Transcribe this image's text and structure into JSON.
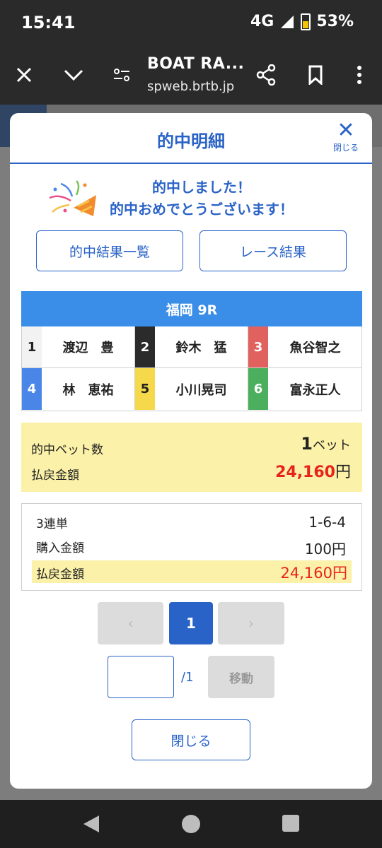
{
  "status_bar": {
    "time": "15:41",
    "network": "4G",
    "battery": "53%"
  },
  "browser": {
    "title": "BOAT RA...",
    "url": "spweb.brtb.jp"
  },
  "modal": {
    "title": "的中明細",
    "close_label": "閉じる",
    "congrats_line1": "的中しました！",
    "congrats_line2": "的中おめでとうございます！",
    "btn_hit_list": "的中結果一覧",
    "btn_race_result": "レース結果",
    "race_header": "福岡 9R",
    "racers": [
      {
        "num": "1",
        "name": "渡辺　豊",
        "bg": "#f2f2f2",
        "fg": "#222222"
      },
      {
        "num": "2",
        "name": "鈴木　猛",
        "bg": "#2b2b2b",
        "fg": "#ffffff"
      },
      {
        "num": "3",
        "name": "魚谷智之",
        "bg": "#e0615d",
        "fg": "#ffffff"
      },
      {
        "num": "4",
        "name": "林　恵祐",
        "bg": "#4a86e8",
        "fg": "#ffffff"
      },
      {
        "num": "5",
        "name": "小川晃司",
        "bg": "#f5d94a",
        "fg": "#222222"
      },
      {
        "num": "6",
        "name": "富永正人",
        "bg": "#4caf5e",
        "fg": "#ffffff"
      }
    ],
    "summary": {
      "bet_count_label": "的中ベット数",
      "bet_count_value": "1",
      "bet_count_unit": "ベット",
      "payout_label": "払戻金額",
      "payout_value": "24,160",
      "payout_unit": "円"
    },
    "detail": {
      "bet_type": "3連単",
      "combination": "1-6-4",
      "purchase_label": "購入金額",
      "purchase_value": "100円",
      "payout_label": "払戻金額",
      "payout_value": "24,160円"
    },
    "pagination": {
      "prev": "‹",
      "current": "1",
      "next": "›",
      "total": "/1",
      "move_label": "移動"
    },
    "close_button": "閉じる"
  },
  "colors": {
    "accent": "#2a63c7",
    "header_blue": "#3b8ee8",
    "highlight": "#fbf1a8",
    "payout_red": "#e8231c"
  }
}
